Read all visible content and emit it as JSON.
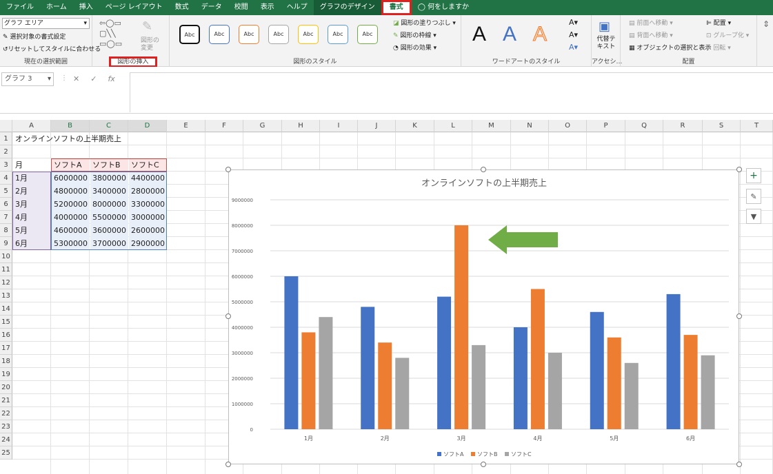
{
  "tabs": [
    "ファイル",
    "ホーム",
    "挿入",
    "ページ レイアウト",
    "数式",
    "データ",
    "校閲",
    "表示",
    "ヘルプ",
    "グラフのデザイン",
    "書式",
    "何をしますか"
  ],
  "ribbon": {
    "selection_dropdown": "グラフ エリア",
    "format_selection": "選択対象の書式設定",
    "reset_style": "リセットしてスタイルに合わせる",
    "group_current_selection": "現在の選択範囲",
    "change_shape": "図形の変更",
    "group_insert_shapes": "図形の挿入",
    "abc": "Abc",
    "shape_fill": "図形の塗りつぶし",
    "shape_outline": "図形の枠線",
    "shape_effects": "図形の効果",
    "group_shape_styles": "図形のスタイル",
    "wordart_letter": "A",
    "group_wordart": "ワードアートのスタイル",
    "alt_text": "代替テキスト",
    "group_accessibility": "アクセシ…",
    "bring_forward": "前面へ移動",
    "send_backward": "背面へ移動",
    "selection_pane": "オブジェクトの選択と表示",
    "align": "配置",
    "group": "グループ化",
    "rotate": "回転",
    "group_arrange": "配置"
  },
  "formula_bar": {
    "name_box": "グラフ 3",
    "cancel": "✕",
    "enter": "✓",
    "fx": "fx"
  },
  "columns": [
    "A",
    "B",
    "C",
    "D",
    "E",
    "F",
    "G",
    "H",
    "I",
    "J",
    "K",
    "L",
    "M",
    "N",
    "O",
    "P",
    "Q",
    "R",
    "S",
    "T"
  ],
  "rows": [
    "1",
    "2",
    "3",
    "4",
    "5",
    "6",
    "7",
    "8",
    "9",
    "10",
    "11",
    "12",
    "13",
    "14",
    "15",
    "16",
    "17",
    "18",
    "19",
    "20",
    "21",
    "22",
    "23",
    "24",
    "25"
  ],
  "sheet": {
    "title": "オンラインソフトの上半期売上",
    "headers": [
      "月",
      "ソフトA",
      "ソフトB",
      "ソフトC"
    ],
    "data": [
      [
        "1月",
        "6000000",
        "3800000",
        "4400000"
      ],
      [
        "2月",
        "4800000",
        "3400000",
        "2800000"
      ],
      [
        "3月",
        "5200000",
        "8000000",
        "3300000"
      ],
      [
        "4月",
        "4000000",
        "5500000",
        "3000000"
      ],
      [
        "5月",
        "4600000",
        "3600000",
        "2600000"
      ],
      [
        "6月",
        "5300000",
        "3700000",
        "2900000"
      ]
    ]
  },
  "chart_data": {
    "type": "bar",
    "title": "オンラインソフトの上半期売上",
    "categories": [
      "1月",
      "2月",
      "3月",
      "4月",
      "5月",
      "6月"
    ],
    "series": [
      {
        "name": "ソフトA",
        "values": [
          6000000,
          4800000,
          5200000,
          4000000,
          4600000,
          5300000
        ],
        "color": "#4472c4"
      },
      {
        "name": "ソフトB",
        "values": [
          3800000,
          3400000,
          8000000,
          5500000,
          3600000,
          3700000
        ],
        "color": "#ed7d31"
      },
      {
        "name": "ソフトC",
        "values": [
          4400000,
          2800000,
          3300000,
          3000000,
          2600000,
          2900000
        ],
        "color": "#a5a5a5"
      }
    ],
    "ylim": [
      0,
      9000000
    ],
    "yticks": [
      "0",
      "1000000",
      "2000000",
      "3000000",
      "4000000",
      "5000000",
      "6000000",
      "7000000",
      "8000000",
      "9000000"
    ],
    "grid": true,
    "legend": "bottom"
  },
  "colors": {
    "excel_green": "#217346",
    "highlight_red": "#e0201f",
    "arrow_green": "#70ad47"
  },
  "chart_tools": {
    "add_element": "+",
    "styles": "brush-icon",
    "filter": "filter-icon"
  }
}
